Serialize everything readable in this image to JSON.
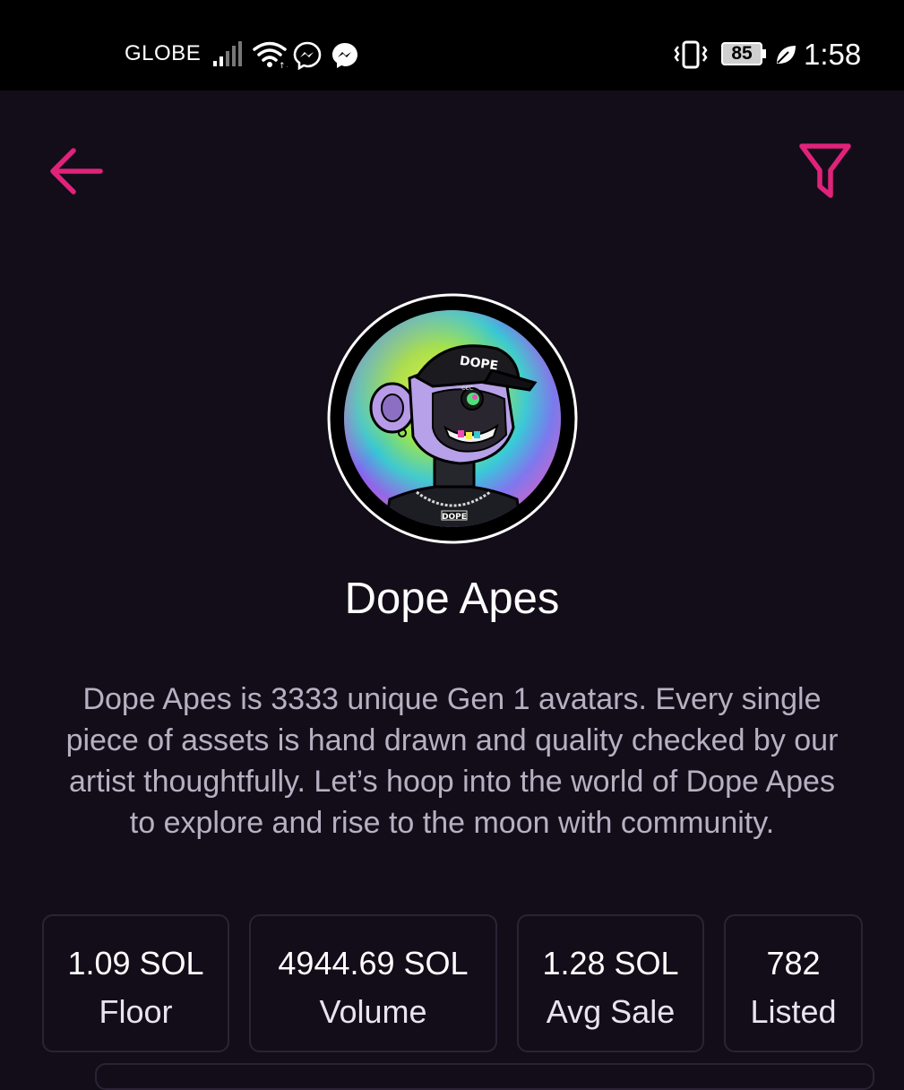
{
  "status_bar": {
    "carrier": "GLOBE",
    "battery": "85",
    "time": "1:58",
    "icons": [
      "signal-icon",
      "wifi-icon",
      "messenger-icon",
      "messenger-icon",
      "vibrate-icon",
      "battery-icon",
      "leaf-icon"
    ]
  },
  "nav": {
    "back_icon": "arrow-left-icon",
    "filter_icon": "filter-icon",
    "accent_color": "#e0237a"
  },
  "collection": {
    "avatar_cap_text": "DOPE",
    "avatar_shirt_text": "DOPE",
    "title": "Dope Apes",
    "description": "Dope Apes is 3333 unique Gen 1 avatars. Every single piece of assets is hand drawn and quality checked by our artist thoughtfully. Let’s hoop into the world of Dope Apes to explore and rise to the moon with community."
  },
  "stats": [
    {
      "value": "1.09 SOL",
      "label": "Floor"
    },
    {
      "value": "4944.69 SOL",
      "label": "Volume"
    },
    {
      "value": "1.28 SOL",
      "label": "Avg Sale"
    },
    {
      "value": "782",
      "label": "Listed"
    }
  ]
}
